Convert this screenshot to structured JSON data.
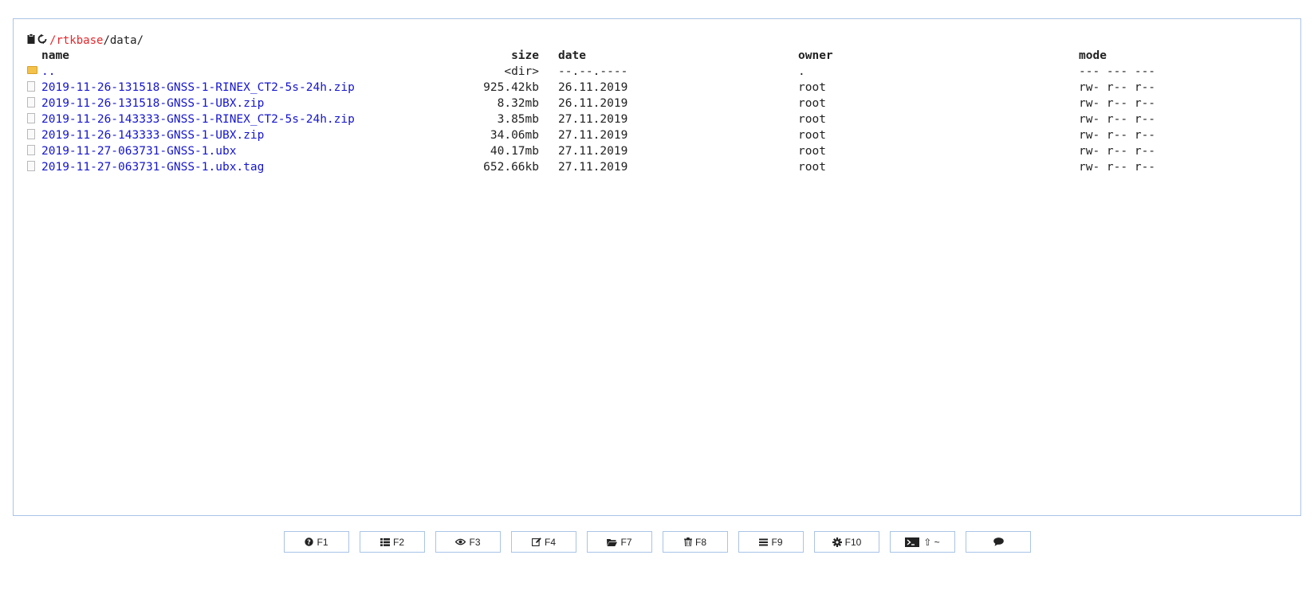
{
  "path": {
    "clipboard_icon": "clipboard-icon",
    "refresh_icon": "refresh-icon",
    "root_sep": "/",
    "root": "rtkbase",
    "rest": "/data/"
  },
  "columns": {
    "name": "name",
    "size": "size",
    "date": "date",
    "owner": "owner",
    "mode": "mode"
  },
  "rows": [
    {
      "type": "dir",
      "name": "..",
      "size": "<dir>",
      "date": "--.--.----",
      "owner": ".",
      "mode": "--- --- ---"
    },
    {
      "type": "file",
      "name": "2019-11-26-131518-GNSS-1-RINEX_CT2-5s-24h.zip",
      "size": "925.42kb",
      "date": "26.11.2019",
      "owner": "root",
      "mode": "rw- r-- r--"
    },
    {
      "type": "file",
      "name": "2019-11-26-131518-GNSS-1-UBX.zip",
      "size": "8.32mb",
      "date": "26.11.2019",
      "owner": "root",
      "mode": "rw- r-- r--"
    },
    {
      "type": "file",
      "name": "2019-11-26-143333-GNSS-1-RINEX_CT2-5s-24h.zip",
      "size": "3.85mb",
      "date": "27.11.2019",
      "owner": "root",
      "mode": "rw- r-- r--"
    },
    {
      "type": "file",
      "name": "2019-11-26-143333-GNSS-1-UBX.zip",
      "size": "34.06mb",
      "date": "27.11.2019",
      "owner": "root",
      "mode": "rw- r-- r--"
    },
    {
      "type": "file",
      "name": "2019-11-27-063731-GNSS-1.ubx",
      "size": "40.17mb",
      "date": "27.11.2019",
      "owner": "root",
      "mode": "rw- r-- r--"
    },
    {
      "type": "file",
      "name": "2019-11-27-063731-GNSS-1.ubx.tag",
      "size": "652.66kb",
      "date": "27.11.2019",
      "owner": "root",
      "mode": "rw- r-- r--"
    }
  ],
  "buttons": [
    {
      "icon": "help-icon",
      "label": "F1"
    },
    {
      "icon": "list-icon",
      "label": "F2"
    },
    {
      "icon": "eye-icon",
      "label": "F3"
    },
    {
      "icon": "edit-icon",
      "label": "F4"
    },
    {
      "icon": "folder-icon",
      "label": "F7"
    },
    {
      "icon": "trash-icon",
      "label": "F8"
    },
    {
      "icon": "menu-icon",
      "label": "F9"
    },
    {
      "icon": "gear-icon",
      "label": "F10"
    },
    {
      "icon": "terminal-icon",
      "label": "⇧ ~"
    },
    {
      "icon": "chat-icon",
      "label": ""
    }
  ],
  "colors": {
    "border": "#a9c4e6",
    "link": "#1515d0",
    "root_path": "#e8262a"
  }
}
